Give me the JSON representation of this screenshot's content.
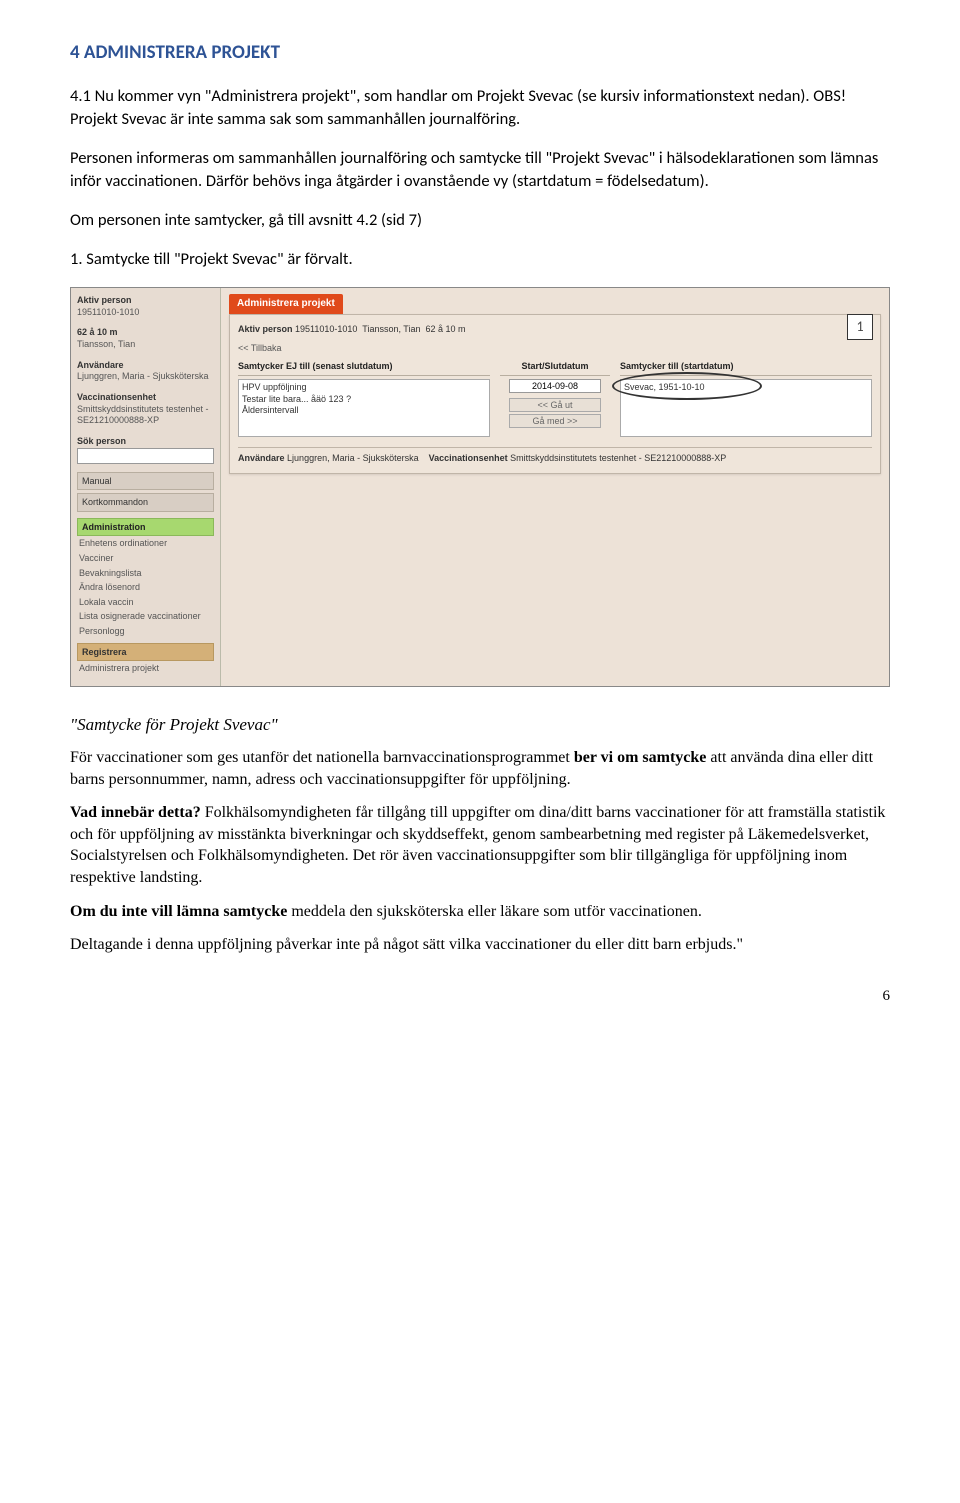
{
  "heading": "4        ADMINISTRERA PROJEKT",
  "p1": "4.1 Nu kommer vyn \"Administrera projekt\", som handlar om Projekt Svevac (se kursiv informationstext nedan). OBS! Projekt Svevac är inte samma sak som sammanhållen journalföring.",
  "p2": "Personen informeras om sammanhållen journalföring och samtycke till \"Projekt Svevac\" i hälsodeklarationen som lämnas inför vaccinationen. Därför behövs inga åtgärder i ovanstående vy (startdatum = födelsedatum).",
  "p3": "Om personen inte samtycker, gå till avsnitt 4.2 (sid 7)",
  "p4": "1. Samtycke till \"Projekt Svevac\" är förvalt.",
  "callout": "1",
  "screenshot": {
    "sidebar": {
      "aktiv_label": "Aktiv person",
      "aktiv_value": "19511010-1010",
      "age_label": "62 å 10 m",
      "name": "Tiansson, Tian",
      "anvandare_label": "Användare",
      "anvandare_value": "Ljunggren, Maria - Sjuksköterska",
      "vacc_label": "Vaccinationsenhet",
      "vacc_value": "Smittskyddsinstitutets testenhet - SE21210000888-XP",
      "sok_label": "Sök person",
      "manual": "Manual",
      "kortkommandon": "Kortkommandon",
      "admin_header": "Administration",
      "admin_items": [
        "Enhetens ordinationer",
        "Vacciner",
        "Bevakningslista",
        "Ändra lösenord",
        "Lokala vaccin",
        "Lista osignerade vaccinationer",
        "Personlogg"
      ],
      "registrera": "Registrera",
      "administrera_projekt": "Administrera projekt"
    },
    "main": {
      "tab": "Administrera projekt",
      "toprow_prefix": "Aktiv person",
      "toprow_id": "19511010-1010",
      "toprow_name": "Tiansson, Tian",
      "toprow_age": "62 å 10 m",
      "back": "<< Tillbaka",
      "col1_hdr": "Samtycker EJ till (senast slutdatum)",
      "col1_items": "HPV uppföljning\nTestar lite bara... åäö 123 ?\nÅldersintervall",
      "col2_hdr": "Start/Slutdatum",
      "date_value": "2014-09-08",
      "btn_ut": "<< Gå ut",
      "btn_med": "Gå med >>",
      "col3_hdr": "Samtycker till (startdatum)",
      "col3_items": "Svevac, 1951-10-10",
      "footer_anv_label": "Användare",
      "footer_anv_val": "Ljunggren, Maria - Sjuksköterska",
      "footer_vacc_label": "Vaccinationsenhet",
      "footer_vacc_val": "Smittskyddsinstitutets testenhet - SE21210000888-XP"
    }
  },
  "quote_heading": "\"Samtycke för Projekt Svevac\"",
  "q1a": "För vaccinationer som ges utanför det nationella barnvaccinationsprogrammet ",
  "q1b": "ber vi om samtycke",
  "q1c": " att använda dina eller ditt barns personnummer, namn, adress och vaccinationsuppgifter för uppföljning.",
  "q2a": "Vad innebär detta?",
  "q2b": " Folkhälsomyndigheten får tillgång till uppgifter om dina/ditt barns vaccinationer för att framställa statistik och för uppföljning av misstänkta biverkningar och skyddseffekt, genom sambearbetning med register på Läkemedelsverket, Socialstyrelsen och Folkhälsomyndigheten. Det rör även vaccinationsuppgifter som blir tillgängliga för uppföljning inom respektive landsting.",
  "q3a": "Om du inte vill lämna samtycke",
  "q3b": " meddela den sjuksköterska eller läkare som utför vaccinationen.",
  "q4": "Deltagande i denna uppföljning påverkar inte på något sätt vilka vaccinationer du eller ditt barn erbjuds.\"",
  "page_number": "6"
}
